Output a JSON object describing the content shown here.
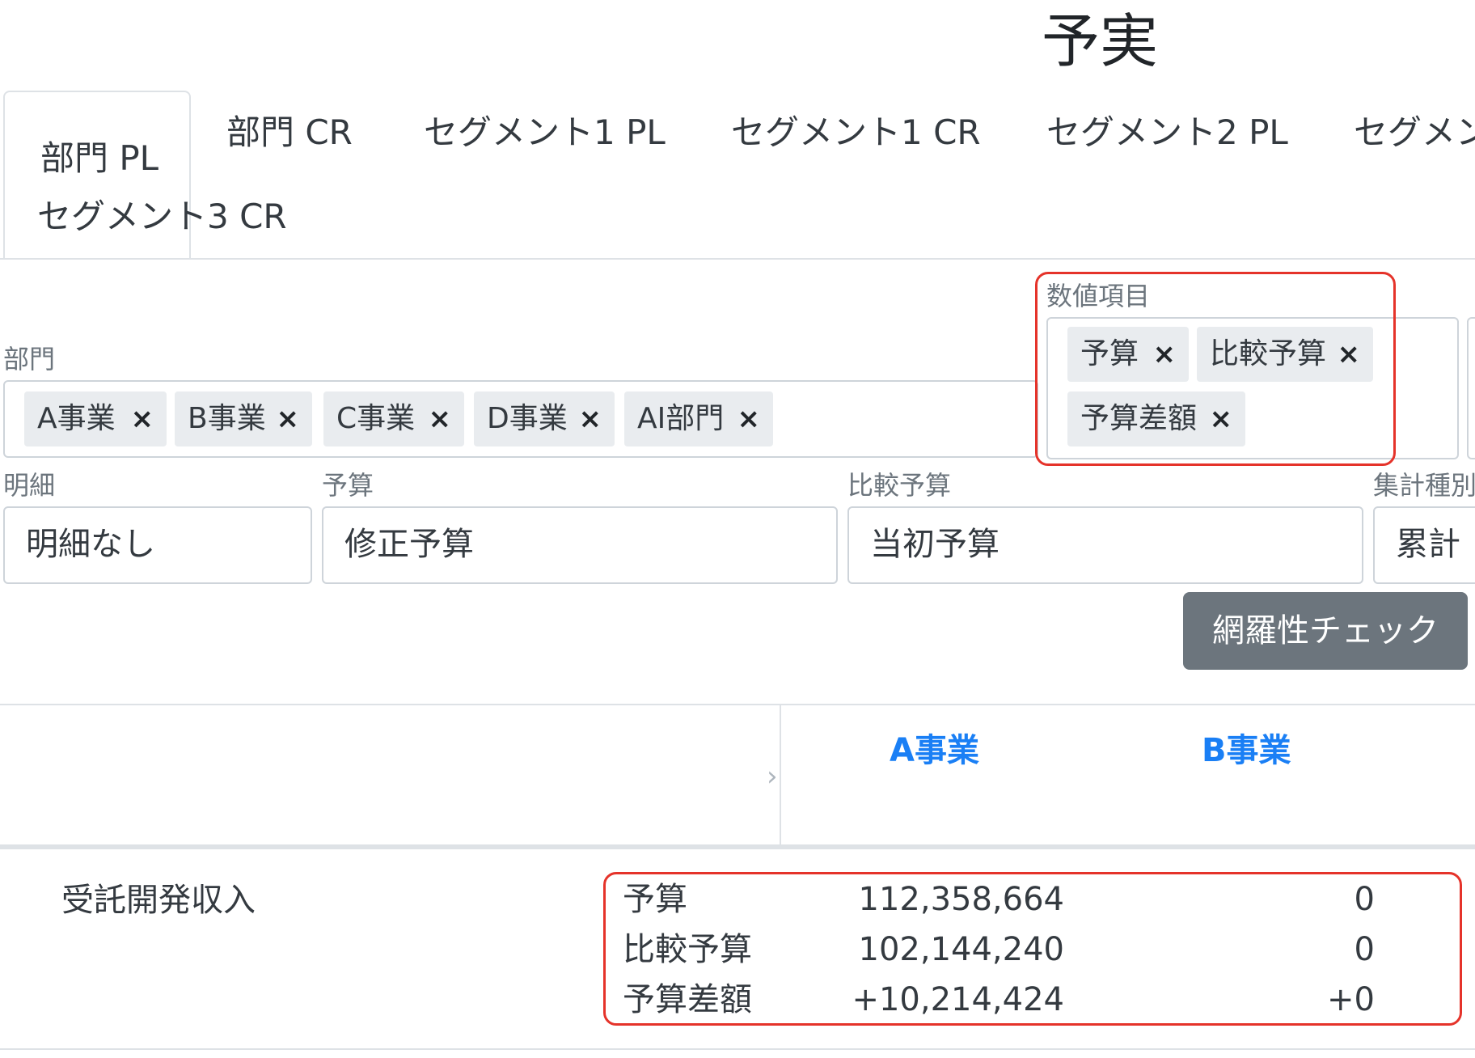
{
  "page": {
    "title": "予実"
  },
  "tabs": [
    {
      "label": "部門 PL",
      "active": true
    },
    {
      "label": "部門 CR"
    },
    {
      "label": "セグメント1 PL"
    },
    {
      "label": "セグメント1 CR"
    },
    {
      "label": "セグメント2 PL"
    },
    {
      "label": "セグメン"
    },
    {
      "label": "セグメント3 CR"
    }
  ],
  "filters": {
    "department": {
      "label": "部門",
      "chips": [
        "A事業",
        "B事業",
        "C事業",
        "D事業",
        "AI部門"
      ],
      "remove_glyph": "×"
    },
    "numeric_items": {
      "label": "数値項目",
      "chips": [
        "予算",
        "比較予算",
        "予算差額"
      ],
      "remove_glyph": "×"
    },
    "detail": {
      "label": "明細",
      "value": "明細なし"
    },
    "budget": {
      "label": "予算",
      "value": "修正予算"
    },
    "compare_budget": {
      "label": "比較予算",
      "value": "当初予算"
    },
    "aggregation": {
      "label": "集計種別",
      "value": "累計"
    }
  },
  "actions": {
    "coverage_check": "網羅性チェック"
  },
  "table": {
    "expand_icon": "›",
    "columns": [
      "A事業",
      "B事業"
    ],
    "rows": [
      {
        "account": "受託開発収入",
        "metrics": [
          {
            "name": "予算",
            "values": [
              "112,358,664",
              "0"
            ]
          },
          {
            "name": "比較予算",
            "values": [
              "102,144,240",
              "0"
            ]
          },
          {
            "name": "予算差額",
            "values": [
              "+10,214,424",
              "+0"
            ]
          }
        ]
      }
    ]
  },
  "highlight_color": "#e5332a"
}
